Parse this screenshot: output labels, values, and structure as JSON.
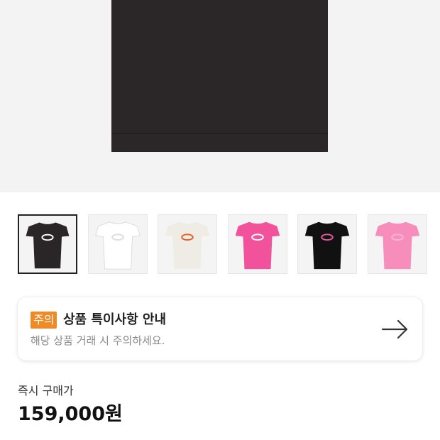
{
  "hero_image": {
    "icon": "product-photo-black-tshirt"
  },
  "thumbnails": [
    {
      "icon": "tshirt-black-thumb",
      "color": "#2a2627",
      "logo": "#ffffff",
      "selected": true
    },
    {
      "icon": "tshirt-white-thumb",
      "color": "#ffffff",
      "logo": "#dddddd",
      "selected": false
    },
    {
      "icon": "tshirt-cream-thumb",
      "color": "#efece6",
      "logo": "#e0622a",
      "selected": false
    },
    {
      "icon": "tshirt-pink-thumb",
      "color": "#f2519b",
      "logo": "#ffffff",
      "selected": false
    },
    {
      "icon": "tshirt-black-pink-logo-thumb",
      "color": "#111111",
      "logo": "#e05a9b",
      "selected": false
    },
    {
      "icon": "tshirt-light-pink-thumb",
      "color": "#f68dbb",
      "logo": "#f8b7d3",
      "selected": false
    }
  ],
  "notice": {
    "badge": "주의",
    "title": "상품 특이사항 안내",
    "subtitle": "해당 상품 거래 시 주의하세요.",
    "badge_color": "#f08a24",
    "arrow_icon": "arrow-right-icon"
  },
  "purchase": {
    "label": "즉시 구매가",
    "price": "159,000원"
  }
}
